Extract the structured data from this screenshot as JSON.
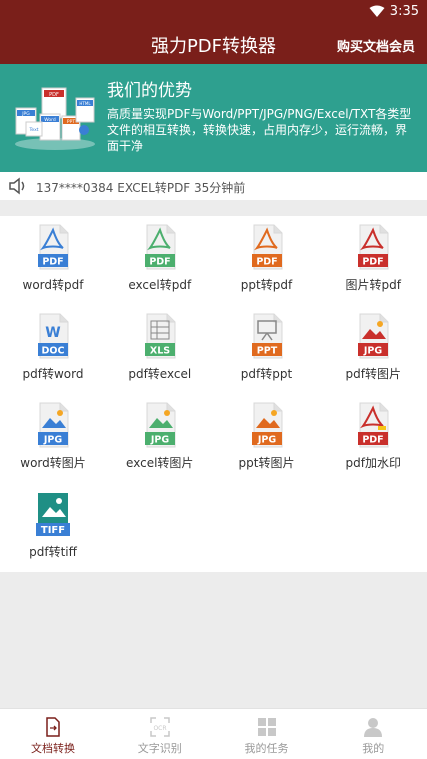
{
  "status": {
    "time": "3:35"
  },
  "header": {
    "title": "强力PDF转换器",
    "vip_label": "购买文档会员"
  },
  "banner": {
    "heading": "我们的优势",
    "body": "高质量实现PDF与Word/PPT/JPG/PNG/Excel/TXT各类型文件的相互转换，转换快速，占用内存少，运行流畅，界面干净",
    "art_labels": [
      "PDF",
      "JPG",
      "Word",
      "PPT",
      "HTML",
      "Text"
    ]
  },
  "notice": {
    "text": "137****0384  EXCEL转PDF  35分钟前"
  },
  "tools": [
    {
      "label": "word转pdf",
      "badge": "PDF",
      "color": "#3a7fd5",
      "glyph": "acrobat"
    },
    {
      "label": "excel转pdf",
      "badge": "PDF",
      "color": "#4caf6e",
      "glyph": "acrobat"
    },
    {
      "label": "ppt转pdf",
      "badge": "PDF",
      "color": "#e06a1f",
      "glyph": "acrobat"
    },
    {
      "label": "图片转pdf",
      "badge": "PDF",
      "color": "#c9302c",
      "glyph": "acrobat"
    },
    {
      "label": "pdf转word",
      "badge": "DOC",
      "color": "#3a7fd5",
      "glyph": "W"
    },
    {
      "label": "pdf转excel",
      "badge": "XLS",
      "color": "#4caf6e",
      "glyph": "sheet"
    },
    {
      "label": "pdf转ppt",
      "badge": "PPT",
      "color": "#e06a1f",
      "glyph": "board"
    },
    {
      "label": "pdf转图片",
      "badge": "JPG",
      "color": "#c9302c",
      "glyph": "image"
    },
    {
      "label": "word转图片",
      "badge": "JPG",
      "color": "#3a7fd5",
      "glyph": "image"
    },
    {
      "label": "excel转图片",
      "badge": "JPG",
      "color": "#4caf6e",
      "glyph": "image"
    },
    {
      "label": "ppt转图片",
      "badge": "JPG",
      "color": "#e06a1f",
      "glyph": "image"
    },
    {
      "label": "pdf加水印",
      "badge": "PDF",
      "color": "#c9302c",
      "glyph": "acrobat-stamp"
    },
    {
      "label": "pdf转tiff",
      "badge": "TIFF",
      "color": "#1f8f85",
      "glyph": "tiff"
    }
  ],
  "tabs": [
    {
      "label": "文档转换",
      "icon": "document-convert-icon",
      "active": true
    },
    {
      "label": "文字识别",
      "icon": "ocr-scan-icon",
      "active": false
    },
    {
      "label": "我的任务",
      "icon": "task-grid-icon",
      "active": false
    },
    {
      "label": "我的",
      "icon": "user-icon",
      "active": false
    }
  ],
  "colors": {
    "brand": "#7a1f1a",
    "banner": "#2ea08f",
    "tab_active": "#7a1f1a",
    "tab_inactive": "#999999"
  }
}
